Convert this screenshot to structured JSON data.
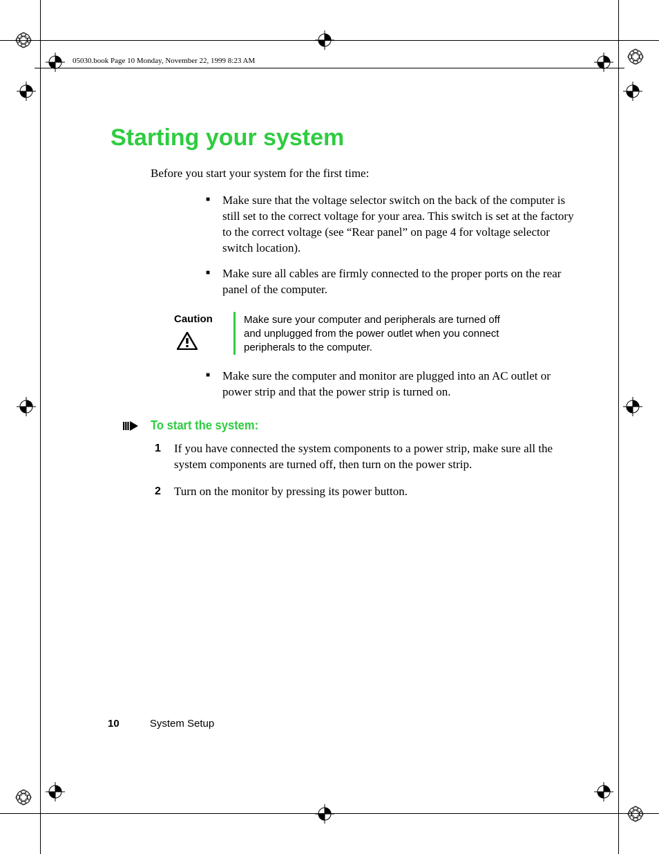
{
  "running_header": "05030.book  Page 10  Monday, November 22, 1999  8:23 AM",
  "title": "Starting your system",
  "intro": "Before you start your system for the first time:",
  "bullets_a": [
    "Make sure that the voltage selector switch on the back of the computer is still set to the correct voltage for your area. This switch is set at the factory to the correct voltage (see “Rear panel” on page 4 for voltage selector switch location).",
    "Make sure all cables are firmly connected to the proper ports on the rear panel of the computer."
  ],
  "caution": {
    "label": "Caution",
    "text": "Make sure your computer and peripherals are turned off and unplugged from the power outlet when you connect peripherals to the computer."
  },
  "bullets_b": [
    "Make sure the computer and monitor are plugged into an AC outlet or power strip and that the power strip is turned on."
  ],
  "subhead": "To start the system:",
  "steps": [
    "If you have connected the system components to a power strip, make sure all the system components are turned off, then turn on the power strip.",
    "Turn on the monitor by pressing its power button."
  ],
  "footer": {
    "page": "10",
    "section": "System Setup"
  }
}
